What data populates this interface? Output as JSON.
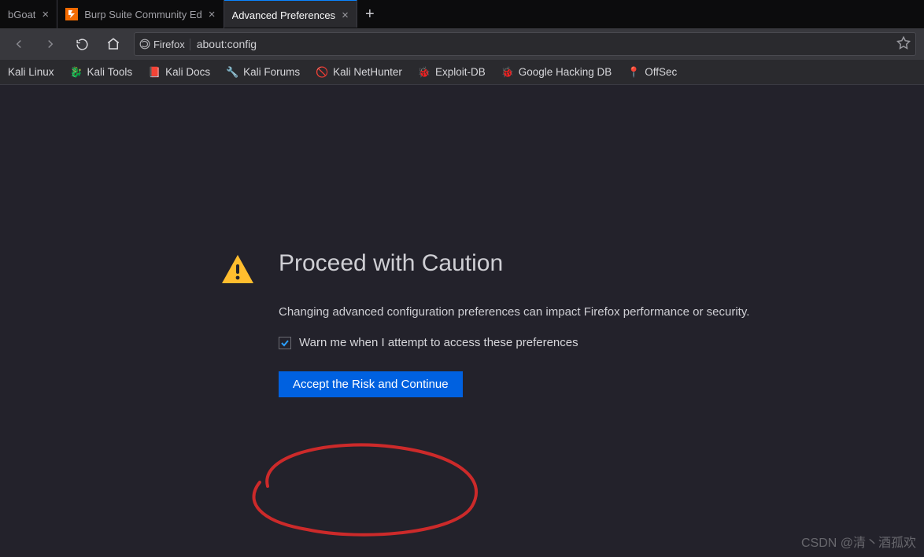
{
  "tabs": [
    {
      "label": "bGoat",
      "active": false,
      "favicon": ""
    },
    {
      "label": "Burp Suite Community Ed",
      "active": false,
      "favicon": "orange"
    },
    {
      "label": "Advanced Preferences",
      "active": true,
      "favicon": ""
    }
  ],
  "urlbar": {
    "identity": "Firefox",
    "url": "about:config"
  },
  "bookmarks": [
    {
      "label": "Kali Linux",
      "icon": ""
    },
    {
      "label": "Kali Tools",
      "icon": "🐉",
      "color": "#4aa3ff"
    },
    {
      "label": "Kali Docs",
      "icon": "📕",
      "color": "#e04050"
    },
    {
      "label": "Kali Forums",
      "icon": "🔧",
      "color": "#5aa0d0"
    },
    {
      "label": "Kali NetHunter",
      "icon": "🚫",
      "color": "#d04040"
    },
    {
      "label": "Exploit-DB",
      "icon": "🐞",
      "color": "#e08a3a"
    },
    {
      "label": "Google Hacking DB",
      "icon": "🐞",
      "color": "#e08a3a"
    },
    {
      "label": "OffSec",
      "icon": "📍",
      "color": "#c04040"
    }
  ],
  "page": {
    "heading": "Proceed with Caution",
    "description": "Changing advanced configuration preferences can impact Firefox performance or security.",
    "checkbox_label": "Warn me when I attempt to access these preferences",
    "checkbox_checked": true,
    "button_label": "Accept the Risk and Continue"
  },
  "watermark": "CSDN @清丶酒孤欢"
}
